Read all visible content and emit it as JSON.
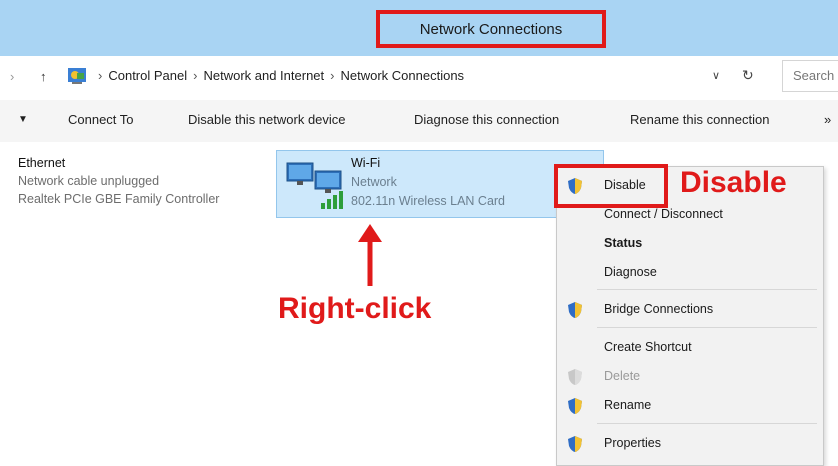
{
  "window": {
    "title": "Network Connections"
  },
  "address_bar": {
    "breadcrumbs": [
      "Control Panel",
      "Network and Internet",
      "Network Connections"
    ],
    "search_placeholder": "Search"
  },
  "toolbar": {
    "items": [
      "Connect To",
      "Disable this network device",
      "Diagnose this connection",
      "Rename this connection"
    ]
  },
  "adapters": [
    {
      "name": "Ethernet",
      "status": "Network cable unplugged",
      "device": "Realtek PCIe GBE Family Controller"
    },
    {
      "name": "Wi-Fi",
      "status": "Network",
      "device": "802.11n Wireless LAN Card"
    }
  ],
  "context_menu": {
    "items": [
      {
        "label": "Disable",
        "icon": "shield-icon",
        "bold": false,
        "enabled": true
      },
      {
        "label": "Connect / Disconnect",
        "icon": "",
        "bold": false,
        "enabled": true
      },
      {
        "label": "Status",
        "icon": "",
        "bold": true,
        "enabled": true
      },
      {
        "label": "Diagnose",
        "icon": "",
        "bold": false,
        "enabled": true
      },
      {
        "label": "Bridge Connections",
        "icon": "shield-icon",
        "bold": false,
        "enabled": true
      },
      {
        "label": "Create Shortcut",
        "icon": "",
        "bold": false,
        "enabled": true
      },
      {
        "label": "Delete",
        "icon": "shield-icon",
        "bold": false,
        "enabled": false
      },
      {
        "label": "Rename",
        "icon": "shield-icon",
        "bold": false,
        "enabled": true
      },
      {
        "label": "Properties",
        "icon": "shield-icon",
        "bold": false,
        "enabled": true
      }
    ]
  },
  "annotations": {
    "right_click": "Right-click",
    "disable": "Disable"
  },
  "colors": {
    "annotation_red": "#e01a1a",
    "titlebar": "#a9d4f3",
    "selection": "#cde8fb"
  }
}
